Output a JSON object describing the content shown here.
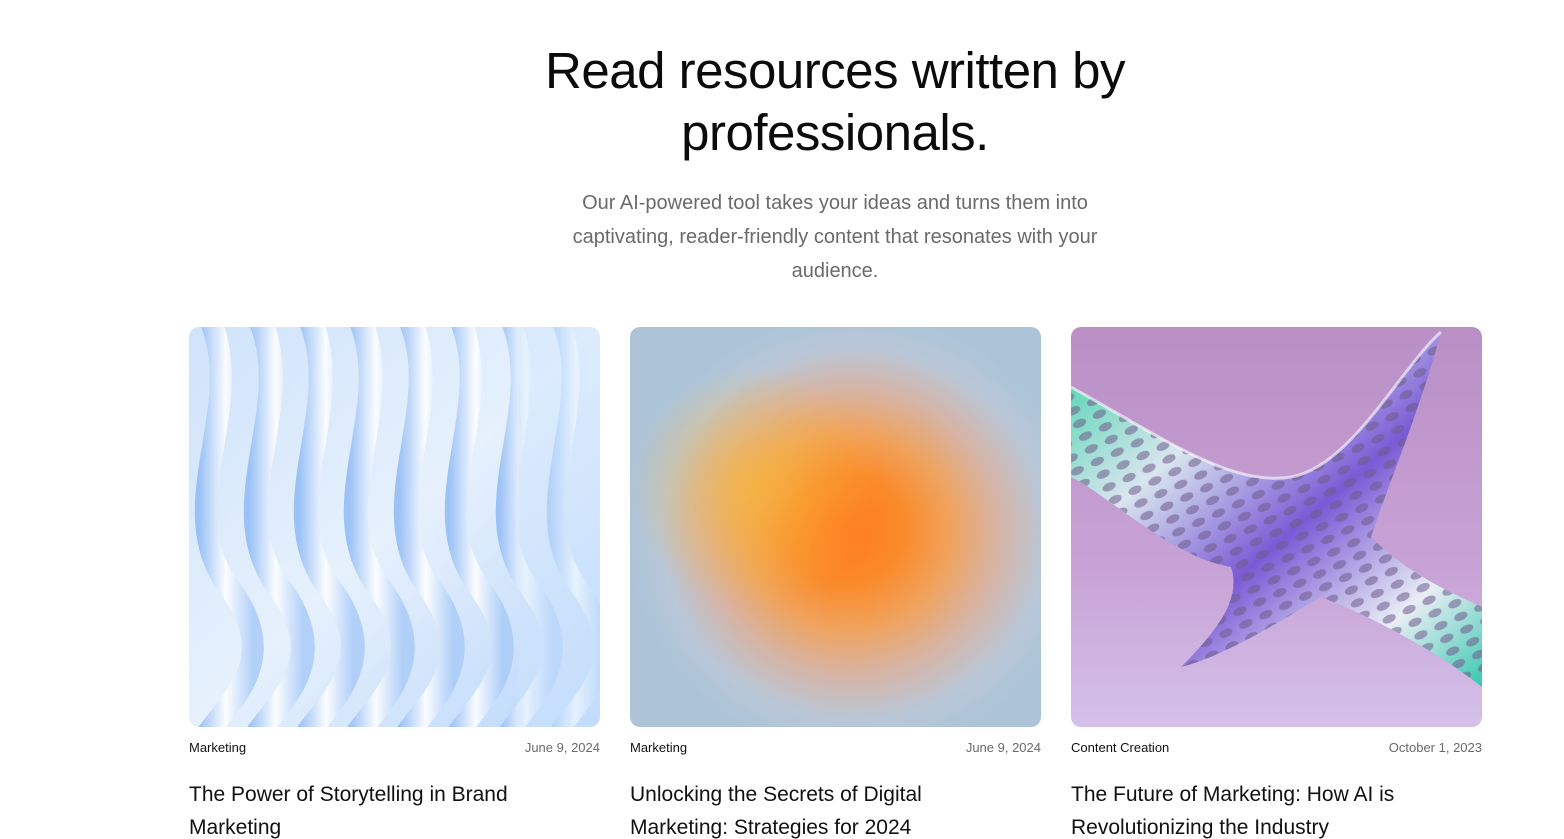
{
  "hero": {
    "title_line1": "Read resources written by",
    "title_line2": "professionals.",
    "subtitle": "Our AI-powered tool takes your ideas and turns them into captivating, reader-friendly content that resonates with your audience."
  },
  "posts": [
    {
      "category": "Marketing",
      "date": "June 9, 2024",
      "title": "The Power of Storytelling in Brand Marketing",
      "image": "blue-wave-abstract"
    },
    {
      "category": "Marketing",
      "date": "June 9, 2024",
      "title": "Unlocking the Secrets of Digital Marketing: Strategies for 2024",
      "image": "orange-gradient-blur"
    },
    {
      "category": "Content Creation",
      "date": "October 1, 2023",
      "title": "The Future of Marketing: How AI is Revolutionizing the Industry",
      "image": "iridescent-mesh-sculpture"
    }
  ],
  "colors": {
    "text": "#111111",
    "muted": "#6a6a6a",
    "background": "#ffffff"
  }
}
